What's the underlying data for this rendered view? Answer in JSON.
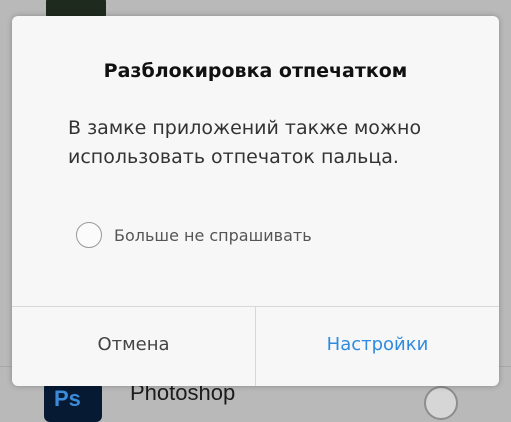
{
  "background": {
    "app_name": "Photoshop",
    "app_icon_text": "Ps"
  },
  "dialog": {
    "title": "Разблокировка отпечатком",
    "message": "В замке приложений также можно использовать отпечаток пальца.",
    "checkbox_label": "Больше не спрашивать",
    "checkbox_checked": false,
    "cancel_label": "Отмена",
    "settings_label": "Настройки"
  },
  "colors": {
    "accent": "#2e8be0",
    "dialog_bg": "#f7f7f7",
    "scrim": "#b9b9b9"
  }
}
